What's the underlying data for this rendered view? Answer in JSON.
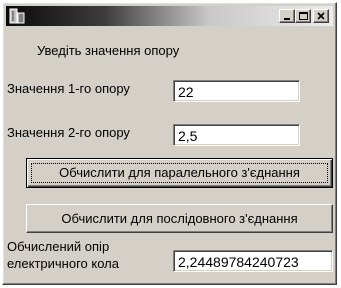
{
  "window": {
    "title": "",
    "app_icon": "app-icon",
    "controls": {
      "minimize_icon": "minimize-icon",
      "maximize_icon": "maximize-icon",
      "close_icon": "close-icon"
    }
  },
  "form": {
    "heading": "Уведіть значення опору",
    "resistor1": {
      "label": "Значення 1-го опору",
      "value": "22"
    },
    "resistor2": {
      "label": "Значення 2-го опору",
      "value": "2,5"
    },
    "parallel_button": "Обчислити для паралельного з'єднання",
    "series_button": "Обчислити для послідовного з'єднання",
    "result": {
      "label_line1": "Обчислений опір",
      "label_line2": "електричного кола",
      "value": "2,24489784240723"
    }
  },
  "colors": {
    "face": "#d4d0c8",
    "title_dark": "#0a0a0a",
    "title_light": "#ececec"
  }
}
